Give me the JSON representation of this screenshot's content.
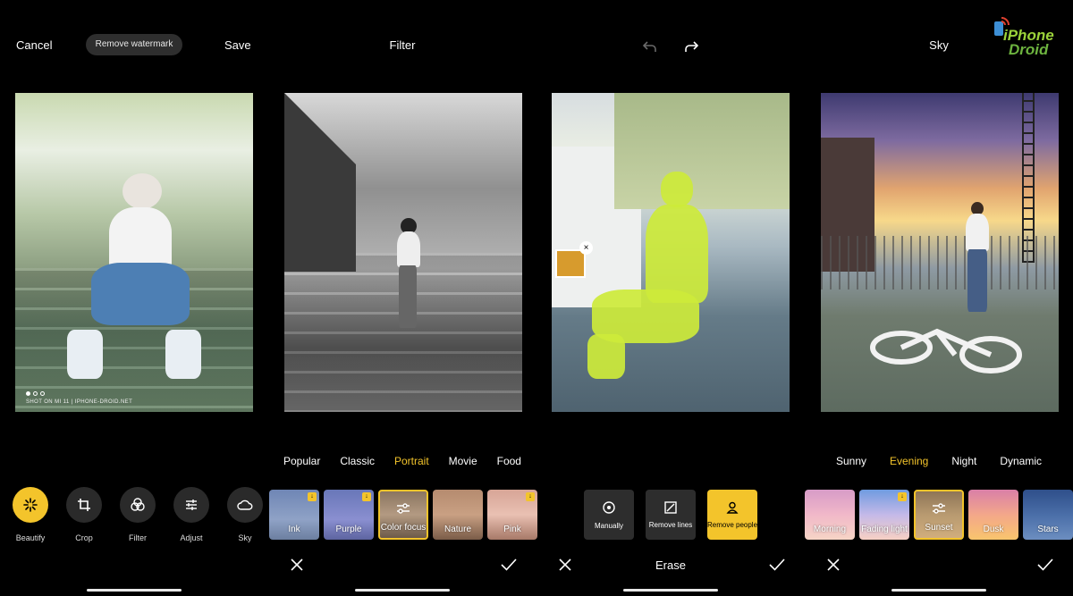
{
  "panel1": {
    "cancel": "Cancel",
    "remove_watermark": "Remove watermark",
    "save": "Save",
    "watermark": "SHOT ON MI 11 | IPHONE-DROID.NET",
    "tools": [
      {
        "label": "Beautify",
        "icon": "beautify-icon",
        "active": true
      },
      {
        "label": "Crop",
        "icon": "crop-icon",
        "active": false
      },
      {
        "label": "Filter",
        "icon": "filter-icon",
        "active": false
      },
      {
        "label": "Adjust",
        "icon": "adjust-icon",
        "active": false
      },
      {
        "label": "Sky",
        "icon": "sky-icon",
        "active": false
      }
    ]
  },
  "panel2": {
    "title": "Filter",
    "categories": [
      "Popular",
      "Classic",
      "Portrait",
      "Movie",
      "Food"
    ],
    "active_category": "Portrait",
    "filters": [
      "Ink",
      "Purple",
      "Color focus",
      "Nature",
      "Pink"
    ],
    "selected_filter": "Color focus"
  },
  "panel3": {
    "options": [
      "Manually",
      "Remove lines",
      "Remove people"
    ],
    "selected_option": "Remove people",
    "mode_title": "Erase"
  },
  "panel4": {
    "title": "Sky",
    "categories": [
      "Sunny",
      "Evening",
      "Night",
      "Dynamic"
    ],
    "active_category": "Evening",
    "skies": [
      "Morning",
      "Fading light",
      "Sunset",
      "Dusk",
      "Stars"
    ],
    "selected_sky": "Sunset"
  },
  "logo": {
    "line1": "iPhone",
    "line2": "Droid"
  },
  "colors": {
    "accent": "#f3c42b",
    "background": "#000000"
  }
}
